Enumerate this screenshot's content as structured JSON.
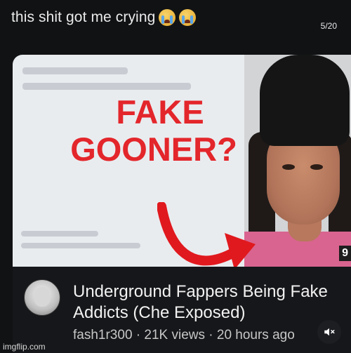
{
  "caption": {
    "text": "this shit got me crying"
  },
  "counter": {
    "text": "5/20"
  },
  "thumbnail": {
    "headline_line1": "FAKE",
    "headline_line2": "GOONER?",
    "badge": "9"
  },
  "video": {
    "title": "Underground  Fappers Being Fake Addicts (Che Exposed)",
    "meta": "fash1r300 · 21K views · 20 hours ago"
  },
  "watermark": {
    "text": "imgflip.com"
  },
  "icons": {
    "crying_emoji_1": "loudly-crying-face-icon",
    "crying_emoji_2": "loudly-crying-face-icon",
    "mute": "speaker-muted-icon",
    "avatar": "channel-avatar"
  },
  "colors": {
    "headline": "#e3262b",
    "arrow": "#e0191e",
    "background": "#111214"
  }
}
